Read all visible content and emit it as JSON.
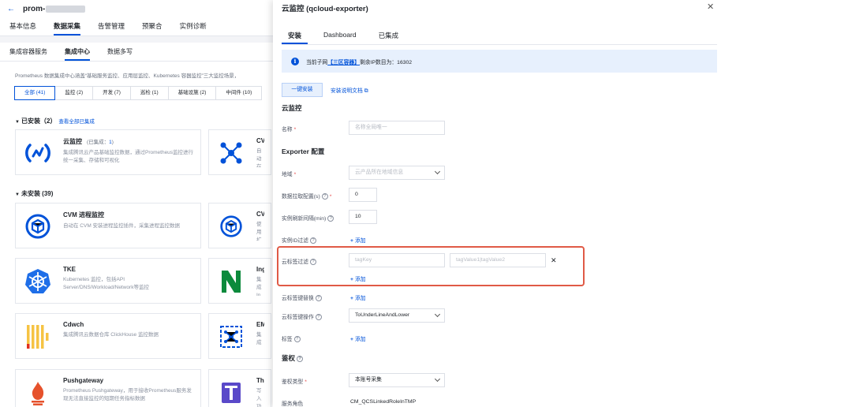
{
  "app": {
    "title": "prom-",
    "back_icon": "arrow-left-icon"
  },
  "top_tabs": [
    {
      "label": "基本信息",
      "active": false
    },
    {
      "label": "数据采集",
      "active": true
    },
    {
      "label": "告警管理",
      "active": false
    },
    {
      "label": "预聚合",
      "active": false
    },
    {
      "label": "实例诊断",
      "active": false
    }
  ],
  "sub_tabs": [
    {
      "label": "集成容器服务",
      "active": false
    },
    {
      "label": "集成中心",
      "active": true
    },
    {
      "label": "数据多写",
      "active": false
    }
  ],
  "description": "Prometheus 数据集成中心涵盖“基础服务监控、应用层监控、Kubernetes 容器监控”三大监控场景，",
  "filters": [
    {
      "label": "全部 (41)",
      "active": true
    },
    {
      "label": "监控 (2)",
      "active": false
    },
    {
      "label": "开发 (7)",
      "active": false
    },
    {
      "label": "巡检 (1)",
      "active": false
    },
    {
      "label": "基础设施 (2)",
      "active": false
    },
    {
      "label": "中间件 (10)",
      "active": false
    }
  ],
  "installed": {
    "heading": "已安装（2）",
    "link": "查看全部已集成"
  },
  "not_installed": {
    "heading": "未安装 (39)"
  },
  "plugins": {
    "cloud_monitor": {
      "name": "云监控",
      "meta_prefix": "(已集成：",
      "meta_count": "1",
      "meta_suffix": ")",
      "desc": "集成腾讯云产品基础监控数据，通过Prometheus监控进行统一采集、存储和可视化"
    },
    "cvm": {
      "name": "CVM",
      "desc": "自动在"
    },
    "cvm_process": {
      "name": "CVM 进程监控",
      "desc": "自动在 CVM 安装进程监控插件，采集进程监控数据"
    },
    "cvm2": {
      "name": "CVM",
      "desc": "使用扩 采集 no"
    },
    "tke": {
      "name": "TKE",
      "desc": "Kubernetes 监控，包括API Server/DNS/Workload/Network等监控"
    },
    "ingress": {
      "name": "Ingre",
      "desc": "集成 In"
    },
    "cdwch": {
      "name": "Cdwch",
      "desc": "集成腾讯云数据仓库 ClickHouse 监控数据"
    },
    "emr": {
      "name": "EMR",
      "desc": "集成"
    },
    "pushgateway": {
      "name": "Pushgateway",
      "desc": "Prometheus Pushgateway，用于接收Prometheus服务发现无法直接监控的短期任务指标数据"
    },
    "thanos": {
      "name": "Thano",
      "desc": "写入功"
    }
  },
  "drawer": {
    "title": "云监控 (qcloud-exporter)",
    "tabs": [
      {
        "label": "安装",
        "active": true
      },
      {
        "label": "Dashboard",
        "active": false
      },
      {
        "label": "已集成",
        "active": false
      }
    ],
    "notice": {
      "prefix": "当前子网",
      "zone": "【三区容器】",
      "suffix": "剩余IP数目为：16302"
    },
    "install_button": "一键安装",
    "doc_link": "安装说明文档",
    "section_cloud": "云监控",
    "name_label": "名称",
    "name_placeholder": "名称全局唯一",
    "section_exporter": "Exporter 配置",
    "region_label": "地域",
    "region_placeholder": "云产品所在地域信息",
    "scrape_label": "数据拉取配置(s)",
    "scrape_value": "0",
    "refresh_label": "实例刷新间隔(min)",
    "refresh_value": "10",
    "instance_filter_label": "实例ID过滤",
    "add_label": "添加",
    "tag_filter_label": "云标签过滤",
    "tag_key_placeholder": "tagKey",
    "tag_value_placeholder": "tagValue1|tagValue2",
    "tag_replace_label": "云标签键替换",
    "tag_op_label": "云标签键操作",
    "tag_op_value": "ToUnderLineAndLower",
    "labels_label": "标签",
    "section_auth": "鉴权",
    "auth_type_label": "鉴权类型",
    "auth_type_value": "本账号采集",
    "service_role_label": "服务角色",
    "service_role_value": "CM_QCSLinkedRoleInTMP"
  },
  "colors": {
    "accent": "#0052d9",
    "highlight": "#e05a46",
    "notice_bg": "#e7f0fd"
  }
}
